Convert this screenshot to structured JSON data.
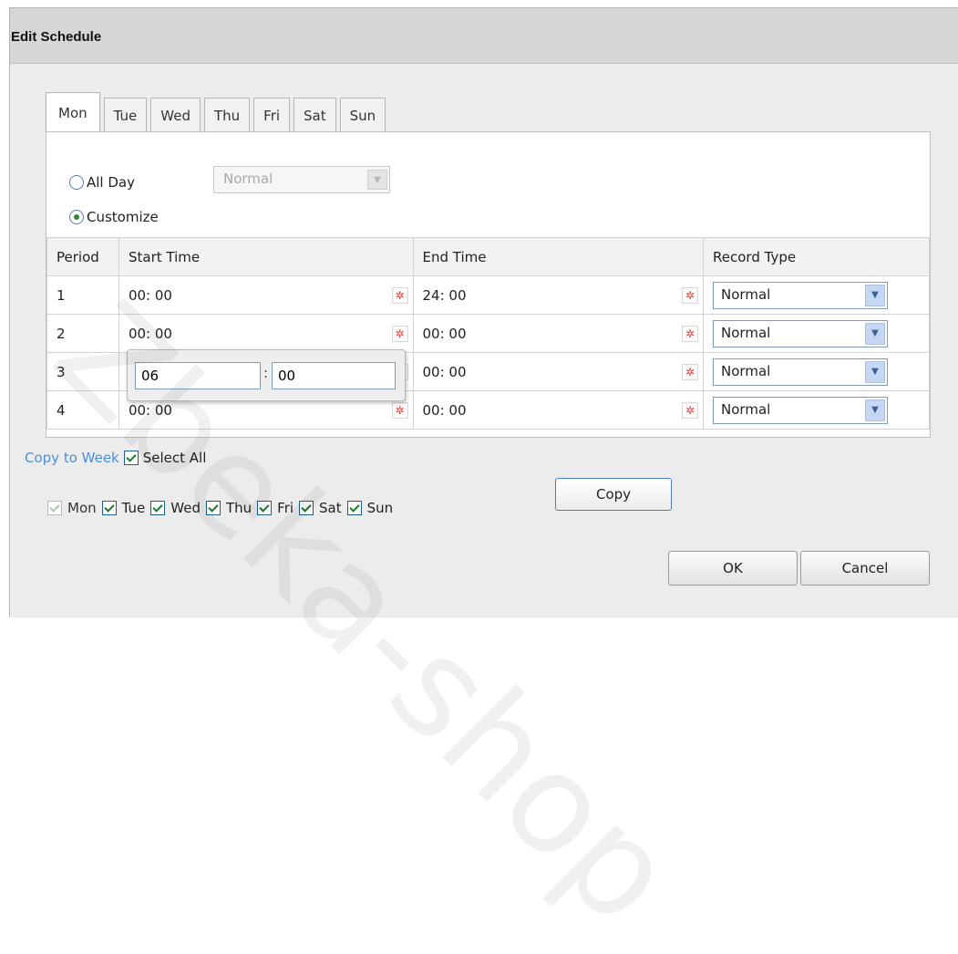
{
  "dialog": {
    "title": "Edit Schedule"
  },
  "tabs": [
    {
      "label": "Mon",
      "active": true
    },
    {
      "label": "Tue",
      "active": false
    },
    {
      "label": "Wed",
      "active": false
    },
    {
      "label": "Thu",
      "active": false
    },
    {
      "label": "Fri",
      "active": false
    },
    {
      "label": "Sat",
      "active": false
    },
    {
      "label": "Sun",
      "active": false
    }
  ],
  "mode": {
    "all_day_label": "All Day",
    "all_day_type": "Normal",
    "customize_label": "Customize",
    "selected": "customize"
  },
  "table": {
    "headers": [
      "Period",
      "Start Time",
      "End Time",
      "Record Type"
    ],
    "rows": [
      {
        "period": "1",
        "start": "00: 00",
        "end": "24: 00",
        "type": "Normal"
      },
      {
        "period": "2",
        "start": "00: 00",
        "end": "00: 00",
        "type": "Normal"
      },
      {
        "period": "3",
        "start": "",
        "end": "00: 00",
        "type": "Normal"
      },
      {
        "period": "4",
        "start": "00: 00",
        "end": "00: 00",
        "type": "Normal"
      }
    ]
  },
  "time_popup": {
    "hour": "06",
    "minute": "00",
    "separator": ":"
  },
  "copy": {
    "copy_to_week": "Copy to Week",
    "select_all": "Select All",
    "days": [
      "Mon",
      "Tue",
      "Wed",
      "Thu",
      "Fri",
      "Sat",
      "Sun"
    ],
    "copy_button": "Copy"
  },
  "buttons": {
    "ok": "OK",
    "cancel": "Cancel"
  },
  "watermark": "Zbeka-shop",
  "colors": {
    "link": "#4a90d9",
    "title_bg": "#d6d6d6",
    "dialog_bg": "#ececec",
    "check": "#1a7a2a"
  },
  "icons": {
    "clock": "clock-icon",
    "dropdown": "chevron-down-icon"
  }
}
